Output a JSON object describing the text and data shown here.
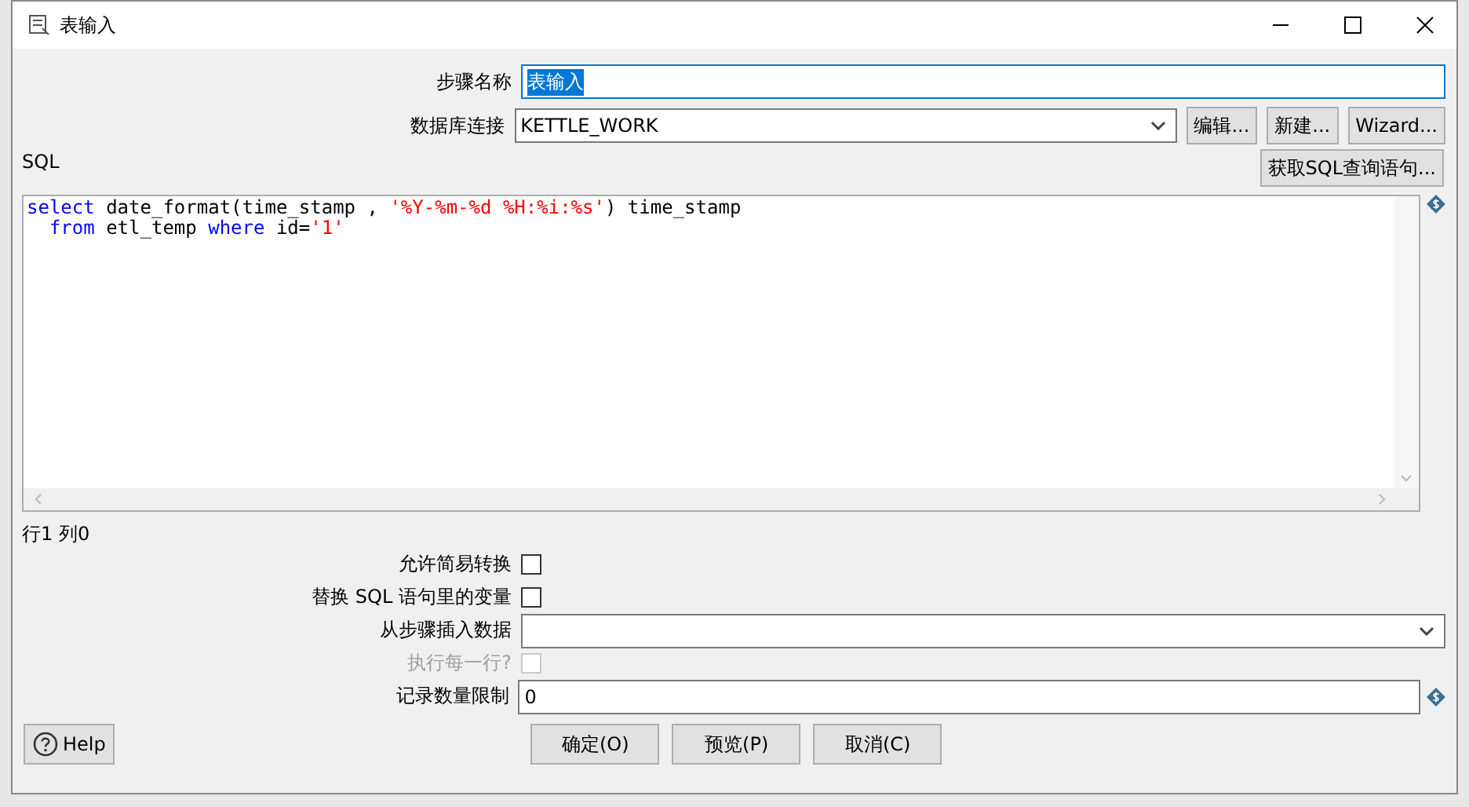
{
  "window": {
    "title": "表输入"
  },
  "step_name": {
    "label": "步骤名称",
    "value": "表输入",
    "selected": true
  },
  "connection": {
    "label": "数据库连接",
    "value": "KETTLE_WORK",
    "buttons": [
      "编辑...",
      "新建...",
      "Wizard..."
    ]
  },
  "sql": {
    "label": "SQL",
    "get_button": "获取SQL查询语句...",
    "lines": [
      [
        {
          "kind": "keyword",
          "text": "select"
        },
        {
          "kind": "plain",
          "text": " date_format(time_stamp , "
        },
        {
          "kind": "string",
          "text": "'%Y-%m-%d %H:%i:%s'"
        },
        {
          "kind": "plain",
          "text": ") time_stamp"
        }
      ],
      [
        {
          "kind": "keyword",
          "text": "  from"
        },
        {
          "kind": "plain",
          "text": " etl_temp "
        },
        {
          "kind": "keyword",
          "text": "where"
        },
        {
          "kind": "plain",
          "text": " id="
        },
        {
          "kind": "string",
          "text": "'1'"
        }
      ]
    ]
  },
  "cursor_position": "行1 列0",
  "options": [
    {
      "kind": "checkbox",
      "label": "允许简易转换",
      "checked": false,
      "disabled": false
    },
    {
      "kind": "checkbox",
      "label": "替换 SQL 语句里的变量",
      "checked": false,
      "disabled": false
    },
    {
      "kind": "dropdown",
      "label": "从步骤插入数据"
    },
    {
      "kind": "checkbox",
      "label": "执行每一行?",
      "checked": false,
      "disabled": true
    },
    {
      "kind": "field",
      "label": "记录数量限制",
      "value": "0"
    }
  ],
  "help_button": "Help",
  "buttons": [
    "确定(O)",
    "预览(P)",
    "取消(C)"
  ]
}
